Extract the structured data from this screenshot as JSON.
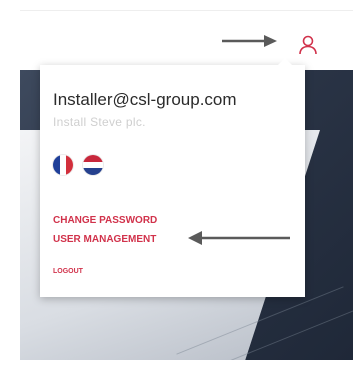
{
  "account": {
    "email": "Installer@csl-group.com",
    "company": "Install Steve plc."
  },
  "languages": [
    {
      "code": "fr",
      "icon": "flag-france-icon"
    },
    {
      "code": "nl",
      "icon": "flag-netherlands-icon"
    }
  ],
  "menu": {
    "change_password": "CHANGE PASSWORD",
    "user_management": "USER MANAGEMENT",
    "logout": "LOGOUT"
  },
  "colors": {
    "accent": "#d1324b",
    "text": "#2b2b2b",
    "muted": "#cfcfcf",
    "annotation_arrow": "#5a5a5a"
  },
  "icons": {
    "account": "user-account-icon",
    "pointer_top": "arrow-right-icon",
    "pointer_menu": "arrow-left-icon"
  }
}
